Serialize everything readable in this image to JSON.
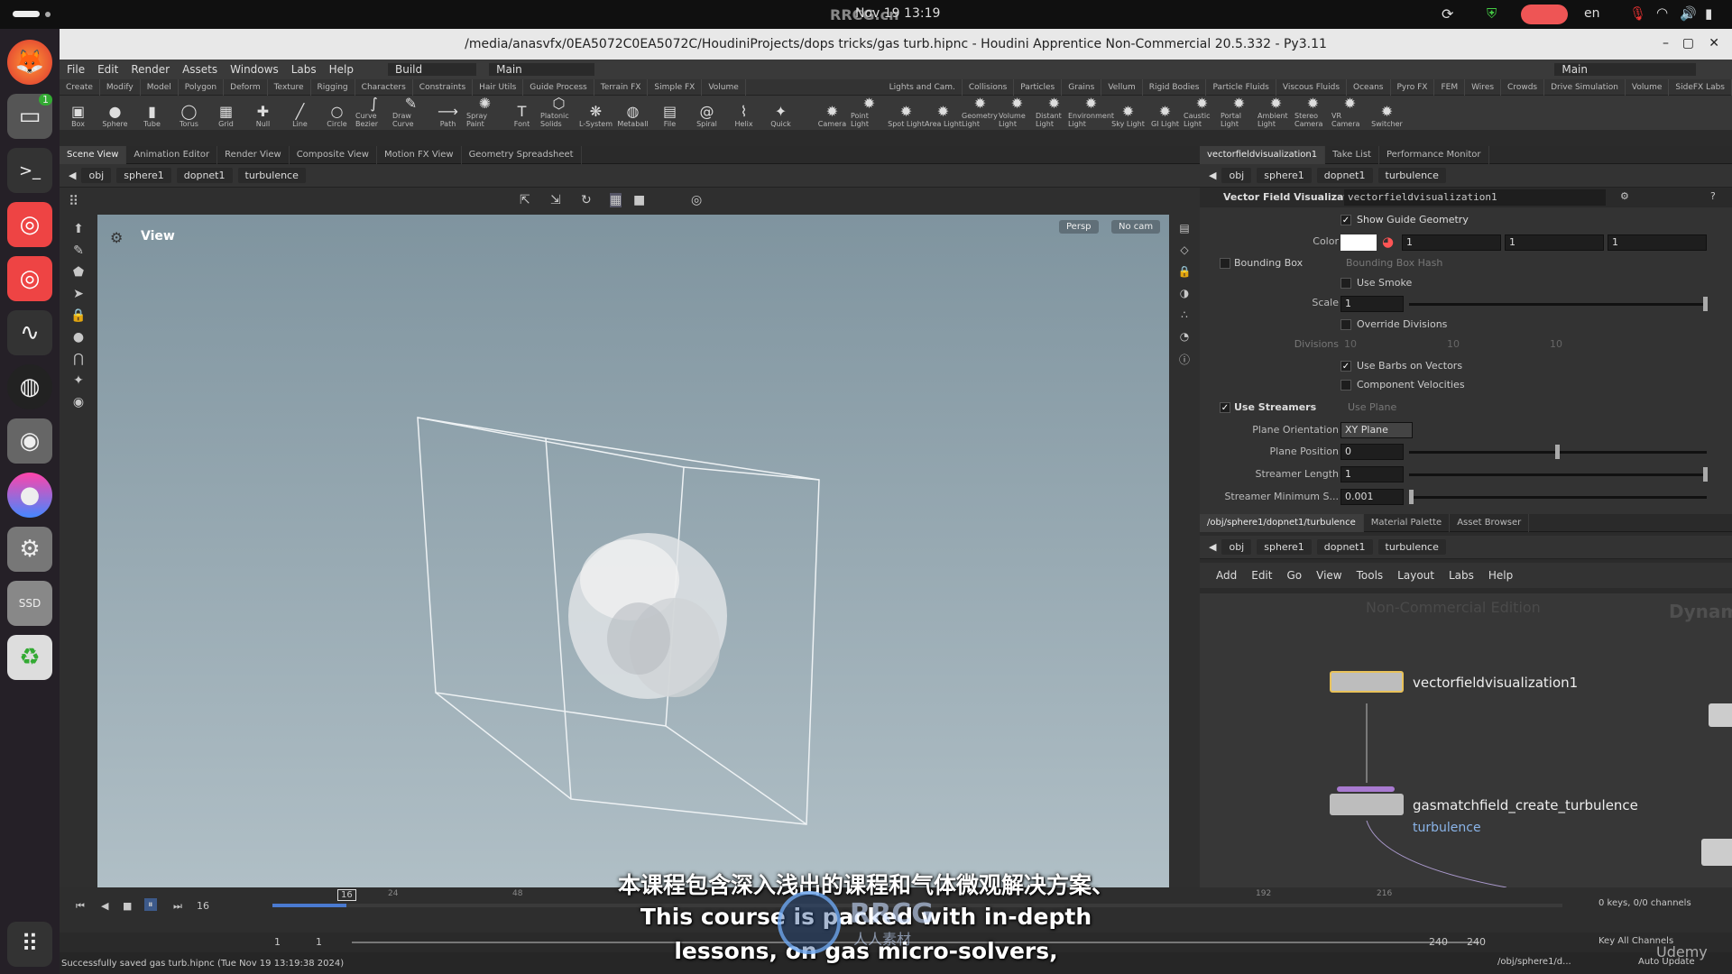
{
  "system": {
    "date_time": "Nov 19  13:19",
    "lang": "en"
  },
  "dock": {
    "badge": "1",
    "ssd_label": "SSD"
  },
  "window": {
    "title": "/media/anasvfx/0EA5072C0EA5072C/HoudiniProjects/dops tricks/gas turb.hipnc - Houdini Apprentice Non-Commercial 20.5.332 - Py3.11"
  },
  "menu": [
    "File",
    "Edit",
    "Render",
    "Assets",
    "Windows",
    "Labs",
    "Help"
  ],
  "desktop_build": "Build",
  "desktop_main": "Main",
  "desktop_main_right": "Main",
  "shelf_tabs_left": [
    "Create",
    "Modify",
    "Model",
    "Polygon",
    "Deform",
    "Texture",
    "Rigging",
    "Characters",
    "Constraints",
    "Hair Utils",
    "Guide Process",
    "Terrain FX",
    "Simple FX",
    "Volume"
  ],
  "shelf_tabs_right": [
    "Lights and Cam.",
    "Collisions",
    "Particles",
    "Grains",
    "Vellum",
    "Rigid Bodies",
    "Particle Fluids",
    "Viscous Fluids",
    "Oceans",
    "Pyro FX",
    "FEM",
    "Wires",
    "Crowds",
    "Drive Simulation",
    "Volume",
    "SideFX Labs"
  ],
  "tools_left": [
    "Box",
    "Sphere",
    "Tube",
    "Torus",
    "Grid",
    "Null",
    "Line",
    "Circle",
    "Curve Bezier",
    "Draw Curve",
    "Path",
    "Spray Paint",
    "Font",
    "Platonic Solids",
    "L-System",
    "Metaball",
    "File",
    "Spiral",
    "Helix",
    "Quick"
  ],
  "tools_right": [
    "Camera",
    "Point Light",
    "Spot Light",
    "Area Light",
    "Geometry Light",
    "Volume Light",
    "Distant Light",
    "Environment Light",
    "Sky Light",
    "GI Light",
    "Caustic Light",
    "Portal Light",
    "Ambient Light",
    "Stereo Camera",
    "VR Camera",
    "Switcher"
  ],
  "left_tabs": [
    "Scene View",
    "Animation Editor",
    "Render View",
    "Composite View",
    "Motion FX View",
    "Geometry Spreadsheet"
  ],
  "right_tabs": [
    "vectorfieldvisualization1",
    "Take List",
    "Performance Monitor"
  ],
  "path": [
    "obj",
    "sphere1",
    "dopnet1",
    "turbulence"
  ],
  "viewport": {
    "label": "View",
    "persp": "Persp",
    "cam": "No cam"
  },
  "params": {
    "type": "Vector Field Visualization",
    "name": "vectorfieldvisualization1",
    "show_guide": "Show Guide Geometry",
    "color_label": "Color",
    "color": [
      "1",
      "1",
      "1"
    ],
    "bounding_box": "Bounding Box",
    "bounding_box_hash": "Bounding Box Hash",
    "use_smoke": "Use Smoke",
    "scale_label": "Scale",
    "scale": "1",
    "override_div": "Override Divisions",
    "divisions_label": "Divisions",
    "divisions": [
      "10",
      "10",
      "10"
    ],
    "use_barbs": "Use Barbs on Vectors",
    "comp_vel": "Component Velocities",
    "use_streamers": "Use Streamers",
    "use_plane": "Use Plane",
    "plane_orient_label": "Plane Orientation",
    "plane_orient": "XY Plane",
    "plane_pos_label": "Plane Position",
    "plane_pos": "0",
    "streamer_len_label": "Streamer Length",
    "streamer_len": "1",
    "streamer_min_label": "Streamer Minimum S...",
    "streamer_min": "0.001"
  },
  "net_tabs": [
    "/obj/sphere1/dopnet1/turbulence",
    "Material Palette",
    "Asset Browser"
  ],
  "net_menu": [
    "Add",
    "Edit",
    "Go",
    "View",
    "Tools",
    "Layout",
    "Labs",
    "Help"
  ],
  "net": {
    "watermark": "Non-Commercial Edition",
    "context": "Dynamics",
    "node1": "vectorfieldvisualization1",
    "node2": "gasmatchfield_create_turbulence",
    "node2_sub": "turbulence"
  },
  "timeline": {
    "frame": "16",
    "marker": "16",
    "ticks": [
      "24",
      "48",
      "192",
      "216"
    ],
    "start": "1",
    "start2": "1",
    "end": "240",
    "end2": "240",
    "keys": "0 keys, 0/0 channels",
    "key_all": "Key All Channels",
    "auto_update": "Auto Update",
    "path": "/obj/sphere1/d..."
  },
  "status": "Successfully saved gas turb.hipnc (Tue Nov 19 13:19:38 2024)",
  "subtitle": {
    "zh": "本课程包含深入浅出的课程和气体微观解决方案、",
    "en1": "This course is packed with in-depth",
    "en2": "lessons, on gas micro-solvers,"
  },
  "watermarks": {
    "top": "RRCG.cn",
    "logo_en": "RRCG",
    "logo_zh": "人人素材",
    "udemy": "Udemy"
  }
}
